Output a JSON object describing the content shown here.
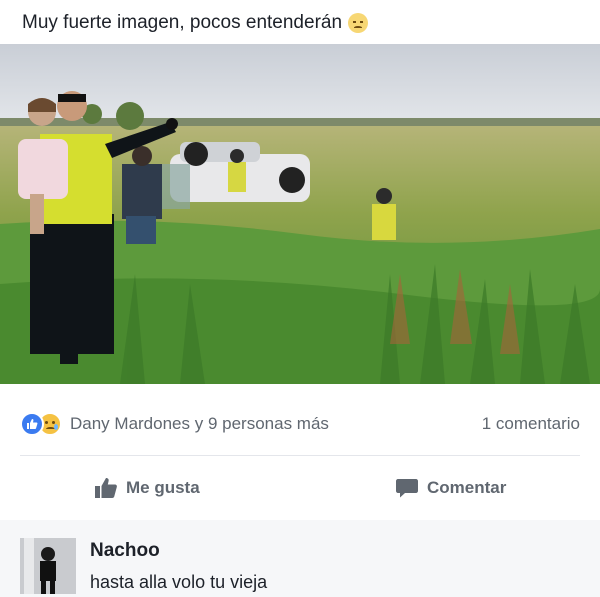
{
  "post": {
    "text": "Muy fuerte imagen, pocos entenderán",
    "emoji": "sad-face-emoji"
  },
  "reactions": {
    "icons": [
      "like-icon",
      "sad-reaction-icon"
    ],
    "summary": "Dany Mardones y 9 personas más",
    "comments_count": "1 comentario"
  },
  "actions": {
    "like_label": "Me gusta",
    "comment_label": "Comentar"
  },
  "comment": {
    "author": "Nachoo",
    "text": "hasta alla volo tu vieja"
  },
  "colors": {
    "like_blue": "#3b7bf0",
    "text_gray": "#606770",
    "comment_bg": "#f6f7f9"
  }
}
